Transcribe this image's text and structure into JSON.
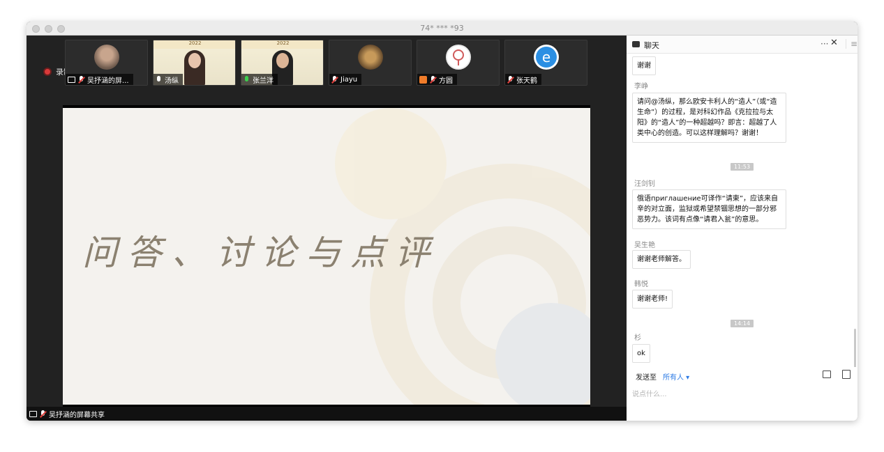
{
  "window": {
    "title": "74* *** *93"
  },
  "recording": {
    "label": "录制中",
    "color": "#d93a3a"
  },
  "participants": [
    {
      "name": "吴抒涵的屏...",
      "icon": "screen-share-icon",
      "mic": "muted",
      "avatar": "avatar-photo"
    },
    {
      "name": "汤纵",
      "icon": "",
      "mic": "on",
      "avatar": "video"
    },
    {
      "name": "张兰洋",
      "icon": "",
      "mic": "active",
      "avatar": "video"
    },
    {
      "name": "Jiayu",
      "icon": "",
      "mic": "muted",
      "avatar": "avatar-bird"
    },
    {
      "name": "方圆",
      "icon": "host-icon",
      "mic": "muted",
      "avatar": "avatar-magnifier"
    },
    {
      "name": "张天鹤",
      "icon": "",
      "mic": "muted",
      "avatar": "avatar-ie"
    }
  ],
  "thumb_banner": "2022",
  "slide": {
    "title": "问答、讨论与点评"
  },
  "share_bar": {
    "label": "吴抒涵的屏幕共享"
  },
  "chat": {
    "title": "聊天",
    "first_msg": "谢谢",
    "messages": [
      {
        "sender": "李峥",
        "text": "请问@汤纵，那么欧安卡利人的“造人”（或“造生命”）的过程，是对科幻作品《克拉拉与太阳》的“造人”的一种超越吗？即言：超越了人类中心的创造。可以这样理解吗？谢谢！"
      },
      {
        "time": "11:53"
      },
      {
        "sender": "汪剑钊",
        "text": "俄语приглашение可译作“请柬”，应该来自辛的对立面，监狱或希望禁锢思想的一部分邪恶势力。该词有点像“请君入瓮”的意思。"
      },
      {
        "sender": "吴生艳",
        "text": "谢谢老师解答。"
      },
      {
        "sender": "韩悦",
        "text": "谢谢老师!"
      },
      {
        "time": "14:14"
      },
      {
        "sender": "杉",
        "text": "ok"
      }
    ],
    "send_to_label": "发送至",
    "send_to_target": "所有人",
    "input_placeholder": "说点什么..."
  }
}
